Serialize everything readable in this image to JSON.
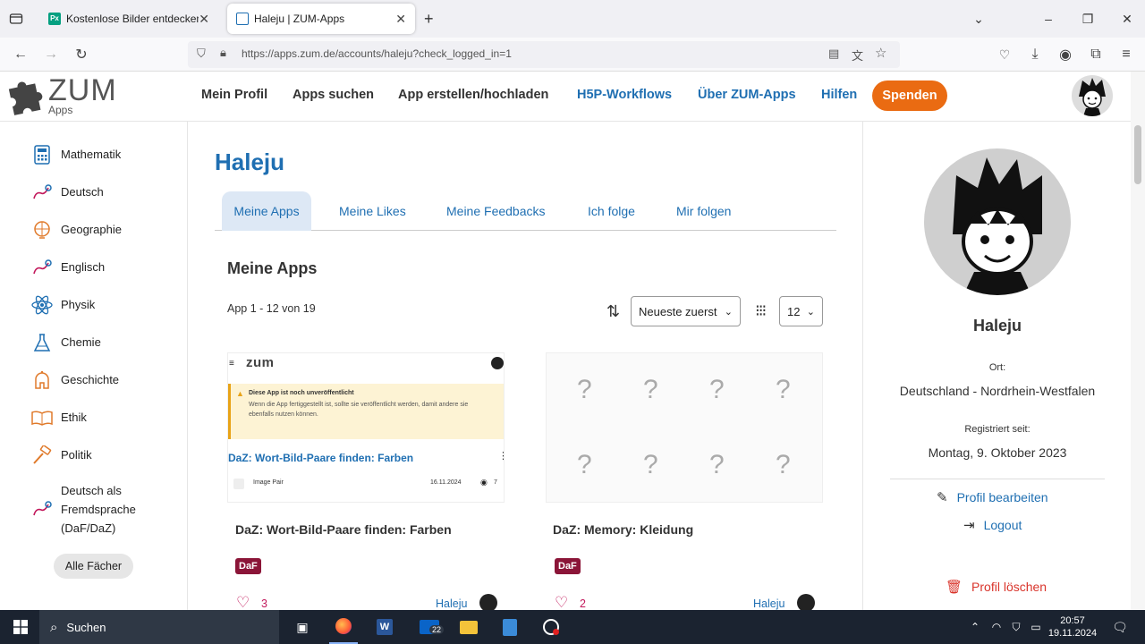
{
  "browser": {
    "tabs": [
      {
        "title": "Kostenlose Bilder entdecken un"
      },
      {
        "title": "Haleju | ZUM-Apps"
      }
    ],
    "url": "https://apps.zum.de/accounts/haleju?check_logged_in=1"
  },
  "site": {
    "logo_text": "ZUM",
    "logo_sub": "Apps",
    "nav": {
      "mein_profil": "Mein Profil",
      "apps_suchen": "Apps suchen",
      "app_erstellen": "App erstellen/hochladen",
      "h5p": "H5P-Workflows",
      "ueber": "Über ZUM-Apps",
      "hilfen": "Hilfen",
      "spenden": "Spenden"
    }
  },
  "sidebar": {
    "items": [
      {
        "label": "Mathematik"
      },
      {
        "label": "Deutsch"
      },
      {
        "label": "Geographie"
      },
      {
        "label": "Englisch"
      },
      {
        "label": "Physik"
      },
      {
        "label": "Chemie"
      },
      {
        "label": "Geschichte"
      },
      {
        "label": "Ethik"
      },
      {
        "label": "Politik"
      },
      {
        "label": "Deutsch als Fremdsprache (DaF/DaZ)"
      }
    ],
    "all_button": "Alle Fächer"
  },
  "main": {
    "title": "Haleju",
    "tabs": [
      {
        "label": "Meine Apps"
      },
      {
        "label": "Meine Likes"
      },
      {
        "label": "Meine Feedbacks"
      },
      {
        "label": "Ich folge"
      },
      {
        "label": "Mir folgen"
      }
    ],
    "section_title": "Meine Apps",
    "count_text": "App 1 - 12 von 19",
    "sort_value": "Neueste zuerst",
    "per_page_value": "12",
    "cards": [
      {
        "preview": {
          "logo_text": "zum",
          "warning_title": "Diese App ist noch unveröffentlicht",
          "warning_body": "Wenn die App fertiggestellt ist, sollte sie veröffentlicht werden, damit andere sie ebenfalls nutzen können.",
          "title": "DaZ: Wort-Bild-Paare finden: Farben",
          "type": "Image Pair",
          "date": "16.11.2024",
          "views": "7"
        },
        "title": "DaZ: Wort-Bild-Paare finden: Farben",
        "tag": "DaF",
        "likes": "3",
        "author": "Haleju"
      },
      {
        "preview": {
          "marks": [
            "?",
            "?",
            "?",
            "?",
            "?",
            "?",
            "?",
            "?"
          ]
        },
        "title": "DaZ: Memory: Kleidung",
        "tag": "DaF",
        "likes": "2",
        "author": "Haleju"
      }
    ]
  },
  "profile": {
    "name": "Haleju",
    "ort_label": "Ort:",
    "ort_value": "Deutschland - Nordrhein-Westfalen",
    "reg_label": "Registriert seit:",
    "reg_value": "Montag, 9. Oktober 2023",
    "edit": "Profil bearbeiten",
    "logout": "Logout",
    "delete": "Profil löschen"
  },
  "taskbar": {
    "search": "Suchen",
    "mail_badge": "22",
    "time": "20:57",
    "date": "19.11.2024"
  },
  "colors": {
    "accent_blue": "#1f6fb2",
    "spenden": "#ea6b12",
    "tag": "#8b1538",
    "delete": "#d9342b"
  }
}
